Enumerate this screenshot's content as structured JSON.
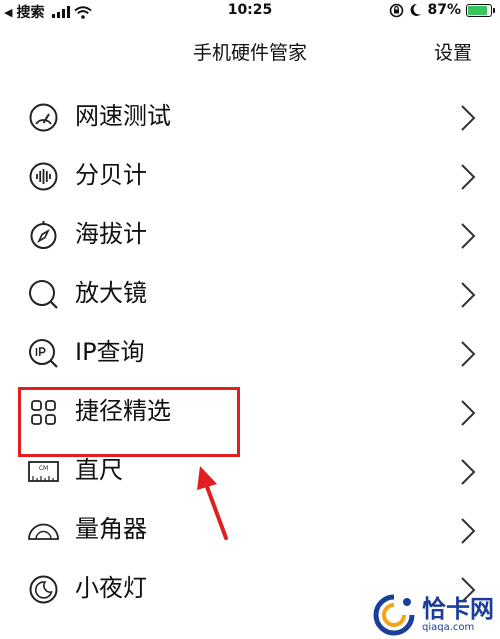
{
  "status_bar": {
    "back_app": "搜索",
    "time": "10:25",
    "battery_percent": "87%",
    "battery_level": 0.87,
    "battery_color": "#36c65b"
  },
  "nav": {
    "title": "手机硬件管家",
    "settings_label": "设置"
  },
  "list": {
    "items": [
      {
        "icon": "partial-icon",
        "label": ""
      },
      {
        "icon": "speedometer-icon",
        "label": "网速测试"
      },
      {
        "icon": "sound-wave-icon",
        "label": "分贝计"
      },
      {
        "icon": "compass-icon",
        "label": "海拔计"
      },
      {
        "icon": "magnifier-icon",
        "label": "放大镜"
      },
      {
        "icon": "ip-icon",
        "label": "IP查询"
      },
      {
        "icon": "grid-icon",
        "label": "捷径精选"
      },
      {
        "icon": "ruler-icon",
        "label": "直尺"
      },
      {
        "icon": "protractor-icon",
        "label": "量角器"
      },
      {
        "icon": "moon-icon",
        "label": "小夜灯"
      }
    ]
  },
  "annotation": {
    "highlight_color": "#e02020",
    "highlighted_item": "捷径精选"
  },
  "watermark": {
    "title": "恰卡网",
    "url": "qiaqa.com",
    "color": "#1b3e9b"
  }
}
